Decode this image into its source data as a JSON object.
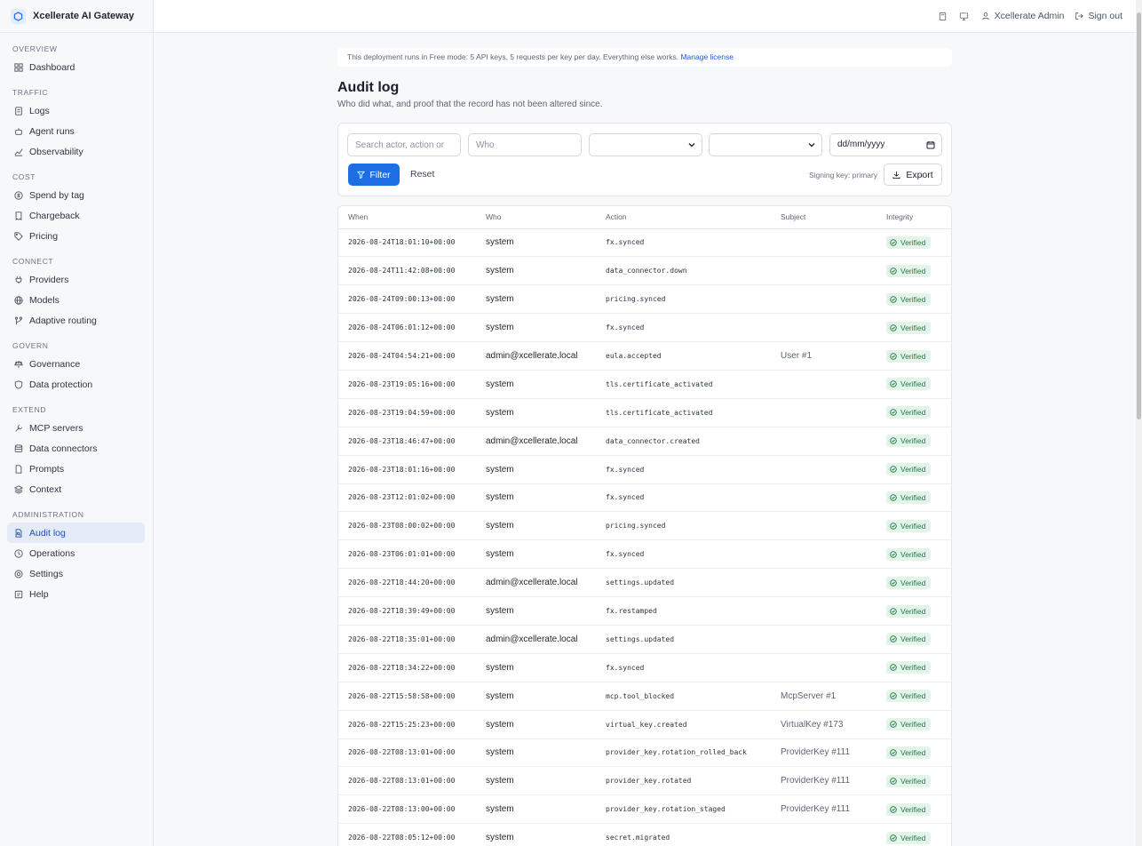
{
  "app": {
    "name": "Xcellerate AI Gateway"
  },
  "sidebar": {
    "sections": [
      {
        "heading": "OVERVIEW",
        "items": [
          {
            "label": "Dashboard",
            "icon": "dashboard-icon"
          }
        ]
      },
      {
        "heading": "TRAFFIC",
        "items": [
          {
            "label": "Logs",
            "icon": "logs-icon"
          },
          {
            "label": "Agent runs",
            "icon": "bot-icon"
          },
          {
            "label": "Observability",
            "icon": "chart-icon"
          }
        ]
      },
      {
        "heading": "COST",
        "items": [
          {
            "label": "Spend by tag",
            "icon": "dollar-icon"
          },
          {
            "label": "Chargeback",
            "icon": "receipt-icon"
          },
          {
            "label": "Pricing",
            "icon": "tag-icon"
          }
        ]
      },
      {
        "heading": "CONNECT",
        "items": [
          {
            "label": "Providers",
            "icon": "plug-icon"
          },
          {
            "label": "Models",
            "icon": "globe-icon"
          },
          {
            "label": "Adaptive routing",
            "icon": "routing-icon"
          }
        ]
      },
      {
        "heading": "GOVERN",
        "items": [
          {
            "label": "Governance",
            "icon": "scale-icon"
          },
          {
            "label": "Data protection",
            "icon": "shield-icon"
          }
        ]
      },
      {
        "heading": "EXTEND",
        "items": [
          {
            "label": "MCP servers",
            "icon": "tool-icon"
          },
          {
            "label": "Data connectors",
            "icon": "database-icon"
          },
          {
            "label": "Prompts",
            "icon": "file-icon"
          },
          {
            "label": "Context",
            "icon": "layers-icon"
          }
        ]
      },
      {
        "heading": "ADMINISTRATION",
        "items": [
          {
            "label": "Audit log",
            "icon": "audit-icon",
            "active": true
          },
          {
            "label": "Operations",
            "icon": "ops-icon"
          },
          {
            "label": "Settings",
            "icon": "settings-icon"
          },
          {
            "label": "Help",
            "icon": "help-icon"
          }
        ]
      }
    ]
  },
  "topbar": {
    "user": "Xcellerate Admin",
    "signout": "Sign out"
  },
  "banner": {
    "text": "This deployment runs in Free mode: 5 API keys, 5 requests per key per day. Everything else works.",
    "link": "Manage license"
  },
  "page": {
    "title": "Audit log",
    "subtitle": "Who did what, and proof that the record has not been altered since."
  },
  "filters": {
    "search_placeholder": "Search actor, action or",
    "who_placeholder": "Who",
    "date_placeholder": "dd/mm/yyyy",
    "filter_label": "Filter",
    "reset_label": "Reset",
    "signing_key": "Signing key: primary",
    "export_label": "Export"
  },
  "table": {
    "columns": [
      "When",
      "Who",
      "Action",
      "Subject",
      "Integrity"
    ],
    "rows": [
      [
        "2026-08-24T18:01:10+00:00",
        "system",
        "fx.synced",
        "",
        "Verified"
      ],
      [
        "2026-08-24T11:42:08+00:00",
        "system",
        "data_connector.down",
        "",
        "Verified"
      ],
      [
        "2026-08-24T09:00:13+00:00",
        "system",
        "pricing.synced",
        "",
        "Verified"
      ],
      [
        "2026-08-24T06:01:12+00:00",
        "system",
        "fx.synced",
        "",
        "Verified"
      ],
      [
        "2026-08-24T04:54:21+00:00",
        "admin@xcellerate.local",
        "eula.accepted",
        "User #1",
        "Verified"
      ],
      [
        "2026-08-23T19:05:16+00:00",
        "system",
        "tls.certificate_activated",
        "",
        "Verified"
      ],
      [
        "2026-08-23T19:04:59+00:00",
        "system",
        "tls.certificate_activated",
        "",
        "Verified"
      ],
      [
        "2026-08-23T18:46:47+00:00",
        "admin@xcellerate.local",
        "data_connector.created",
        "",
        "Verified"
      ],
      [
        "2026-08-23T18:01:16+00:00",
        "system",
        "fx.synced",
        "",
        "Verified"
      ],
      [
        "2026-08-23T12:01:02+00:00",
        "system",
        "fx.synced",
        "",
        "Verified"
      ],
      [
        "2026-08-23T08:00:02+00:00",
        "system",
        "pricing.synced",
        "",
        "Verified"
      ],
      [
        "2026-08-23T06:01:01+00:00",
        "system",
        "fx.synced",
        "",
        "Verified"
      ],
      [
        "2026-08-22T18:44:20+00:00",
        "admin@xcellerate.local",
        "settings.updated",
        "",
        "Verified"
      ],
      [
        "2026-08-22T18:39:49+00:00",
        "system",
        "fx.restamped",
        "",
        "Verified"
      ],
      [
        "2026-08-22T18:35:01+00:00",
        "admin@xcellerate.local",
        "settings.updated",
        "",
        "Verified"
      ],
      [
        "2026-08-22T18:34:22+00:00",
        "system",
        "fx.synced",
        "",
        "Verified"
      ],
      [
        "2026-08-22T15:58:58+00:00",
        "system",
        "mcp.tool_blocked",
        "McpServer #1",
        "Verified"
      ],
      [
        "2026-08-22T15:25:23+00:00",
        "system",
        "virtual_key.created",
        "VirtualKey #173",
        "Verified"
      ],
      [
        "2026-08-22T08:13:01+00:00",
        "system",
        "provider_key.rotation_rolled_back",
        "ProviderKey #111",
        "Verified"
      ],
      [
        "2026-08-22T08:13:01+00:00",
        "system",
        "provider_key.rotated",
        "ProviderKey #111",
        "Verified"
      ],
      [
        "2026-08-22T08:13:00+00:00",
        "system",
        "provider_key.rotation_staged",
        "ProviderKey #111",
        "Verified"
      ],
      [
        "2026-08-22T08:05:12+00:00",
        "system",
        "secret.migrated",
        "",
        "Verified"
      ]
    ]
  },
  "colors": {
    "accent": "#1d6ee3",
    "verified_bg": "#e5f4ea",
    "verified_text": "#217a40"
  }
}
